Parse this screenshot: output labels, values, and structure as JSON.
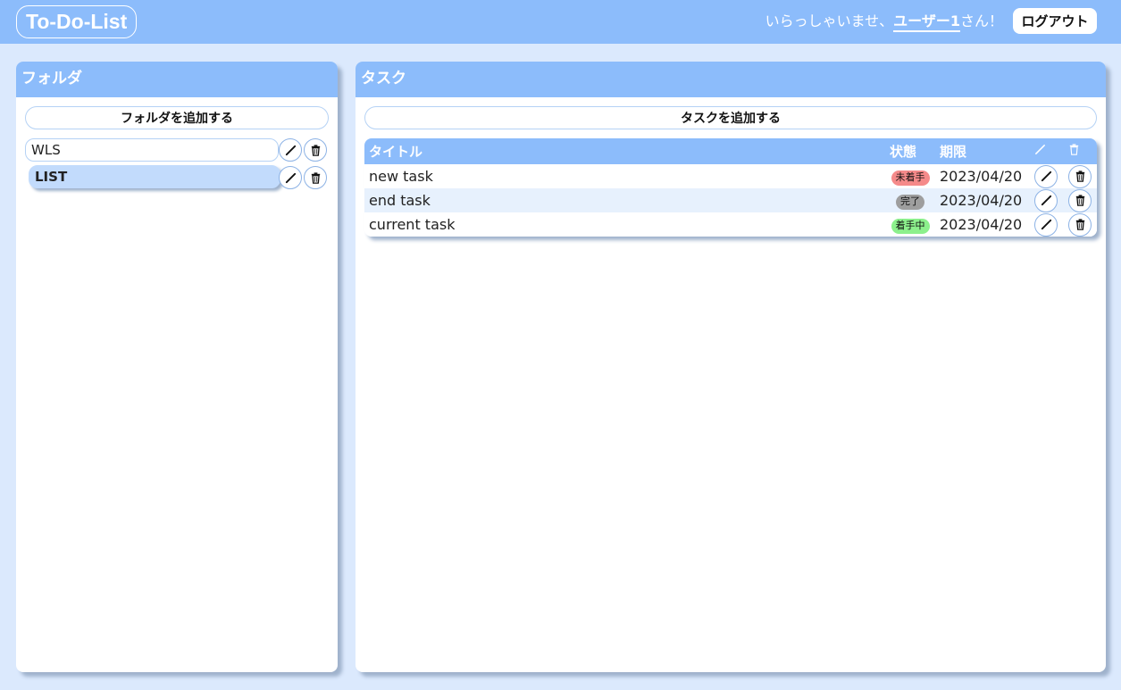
{
  "header": {
    "logo": "To-Do-List",
    "greeting_prefix": "いらっしゃいませ、",
    "user_name": "ユーザー1",
    "greeting_suffix": "さん！",
    "logout_label": "ログアウト"
  },
  "folders_panel": {
    "title": "フォルダ",
    "add_label": "フォルダを追加する",
    "items": [
      {
        "name": "WLS",
        "selected": false
      },
      {
        "name": "LIST",
        "selected": true
      }
    ]
  },
  "tasks_panel": {
    "title": "タスク",
    "add_label": "タスクを追加する",
    "columns": {
      "title": "タイトル",
      "status": "状態",
      "due": "期限"
    },
    "rows": [
      {
        "title": "new task",
        "status": "未着手",
        "status_color": "#f58a8a",
        "due": "2023/04/20"
      },
      {
        "title": "end task",
        "status": "完了",
        "status_color": "#9e9e9e",
        "due": "2023/04/20"
      },
      {
        "title": "current task",
        "status": "着手中",
        "status_color": "#8cf08c",
        "due": "2023/04/20"
      }
    ]
  },
  "colors": {
    "accent": "#8cbcfb",
    "background": "#dbe9fd",
    "selected_folder": "#c2dbfc"
  }
}
